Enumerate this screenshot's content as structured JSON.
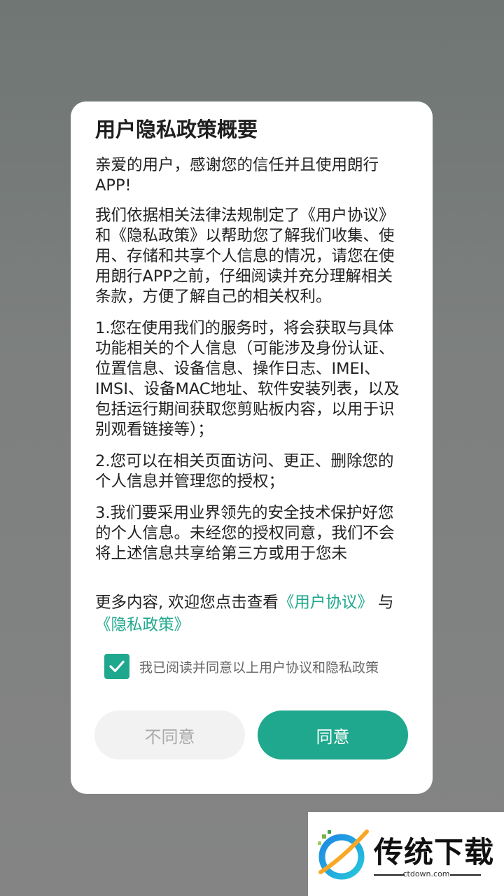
{
  "dialog": {
    "title": "用户隐私政策概要",
    "paragraphs": [
      "亲爱的用户，感谢您的信任并且使用朗行APP!",
      "我们依据相关法律法规制定了《用户协议》和《隐私政策》以帮助您了解我们收集、使用、存储和共享个人信息的情况，请您在使用朗行APP之前，仔细阅读并充分理解相关条款，方便了解自己的相关权利。",
      "1.您在使用我们的服务时，将会获取与具体功能相关的个人信息（可能涉及身份认证、位置信息、设备信息、操作日志、IMEI、IMSI、设备MAC地址、软件安装列表，以及包括运行期间获取您剪贴板内容，以用于识别观看链接等）；",
      "2.您可以在相关页面访问、更正、删除您的个人信息并管理您的授权；",
      "3.我们要采用业界领先的安全技术保护好您的个人信息。未经您的授权同意，我们不会将上述信息共享给第三方或用于您未"
    ],
    "more_prefix": "更多内容, 欢迎您点击查看",
    "user_agreement_link": "《用户协议》",
    "more_conjunction": " 与",
    "privacy_policy_link": "《隐私政策》",
    "consent_checked": true,
    "consent_label": "我已阅读并同意以上用户协议和隐私政策",
    "disagree_label": "不同意",
    "agree_label": "同意"
  },
  "watermark": {
    "brand": "传统下载",
    "domain": "ctdown.com"
  },
  "colors": {
    "accent": "#1fa88d",
    "disagree_bg": "#f2f2f2",
    "overlay": "#7b7e7d"
  }
}
